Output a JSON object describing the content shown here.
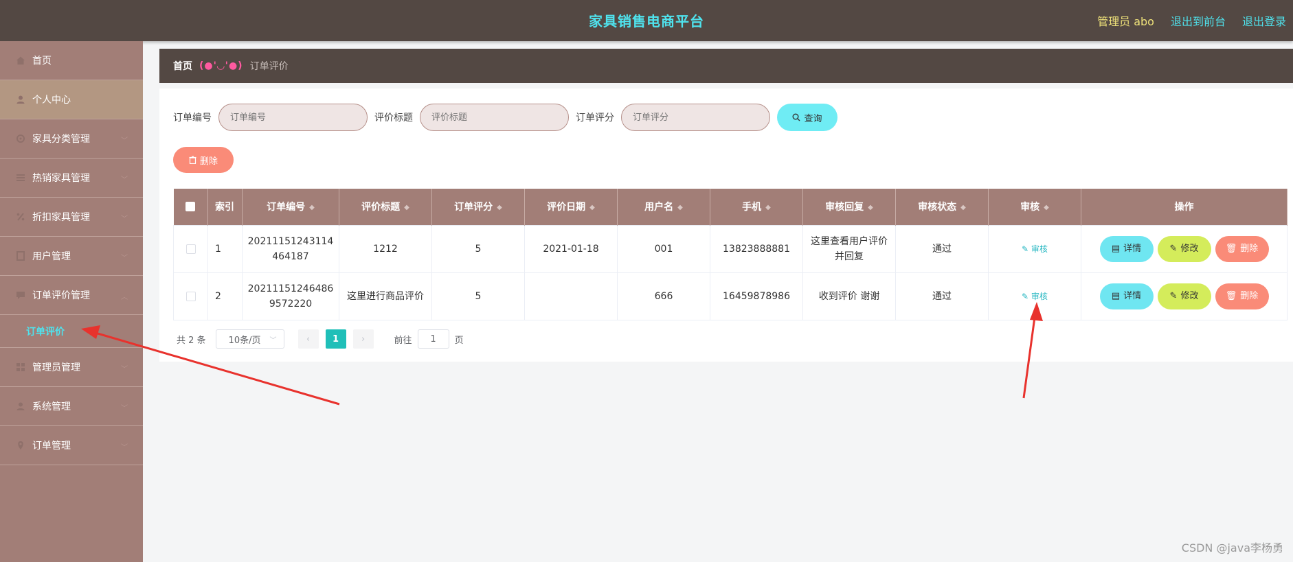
{
  "header": {
    "title": "家具销售电商平台",
    "admin_label": "管理员 abo",
    "exit_front": "退出到前台",
    "logout": "退出登录"
  },
  "sidebar": {
    "items": [
      {
        "label": "首页",
        "icon": "home-icon"
      },
      {
        "label": "个人中心",
        "icon": "user-icon",
        "active": true
      },
      {
        "label": "家具分类管理",
        "icon": "settings-icon"
      },
      {
        "label": "热销家具管理",
        "icon": "list-icon"
      },
      {
        "label": "折扣家具管理",
        "icon": "discount-icon"
      },
      {
        "label": "用户管理",
        "icon": "document-icon"
      },
      {
        "label": "订单评价管理",
        "icon": "chat-icon"
      },
      {
        "label": "管理员管理",
        "icon": "grid-icon"
      },
      {
        "label": "系统管理",
        "icon": "user-icon"
      },
      {
        "label": "订单管理",
        "icon": "location-icon"
      }
    ],
    "sub_item": "订单评价"
  },
  "breadcrumb": {
    "home": "首页",
    "face": "(●'◡'●)",
    "current": "订单评价"
  },
  "search": {
    "order_no_label": "订单编号",
    "order_no_placeholder": "订单编号",
    "review_title_label": "评价标题",
    "review_title_placeholder": "评价标题",
    "order_score_label": "订单评分",
    "order_score_placeholder": "订单评分",
    "query_button": "查询"
  },
  "toolbar": {
    "delete_label": "删除"
  },
  "table": {
    "headers": [
      "索引",
      "订单编号",
      "评价标题",
      "订单评分",
      "评价日期",
      "用户名",
      "手机",
      "审核回复",
      "审核状态",
      "审核",
      "操作"
    ],
    "rows": [
      {
        "index": "1",
        "order_no_line1": "20211151243114",
        "order_no_line2": "464187",
        "title": "1212",
        "score": "5",
        "date": "2021-01-18",
        "username": "001",
        "phone": "13823888881",
        "reply_line1": "这里查看用户评价",
        "reply_line2": "并回复",
        "status": "通过",
        "audit": "审核"
      },
      {
        "index": "2",
        "order_no_line1": "20211151246486",
        "order_no_line2": "9572220",
        "title": "这里进行商品评价",
        "score": "5",
        "date": "",
        "username": "666",
        "phone": "16459878986",
        "reply_line1": "收到评价 谢谢",
        "reply_line2": "",
        "status": "通过",
        "audit": "审核"
      }
    ],
    "actions": {
      "detail": "详情",
      "edit": "修改",
      "delete": "删除"
    }
  },
  "pagination": {
    "total": "共 2 条",
    "page_size": "10条/页",
    "current_page": "1",
    "goto_label": "前往",
    "goto_value": "1",
    "page_unit": "页"
  },
  "watermark": "CSDN @java李杨勇",
  "colors": {
    "header_bg": "#534843",
    "sidebar_bg": "#a27e77",
    "accent_cyan": "#4fe3ee",
    "delete_red": "#fa8b78",
    "edit_green": "#d4ec5b",
    "annotation_arrow": "#e8322d"
  }
}
